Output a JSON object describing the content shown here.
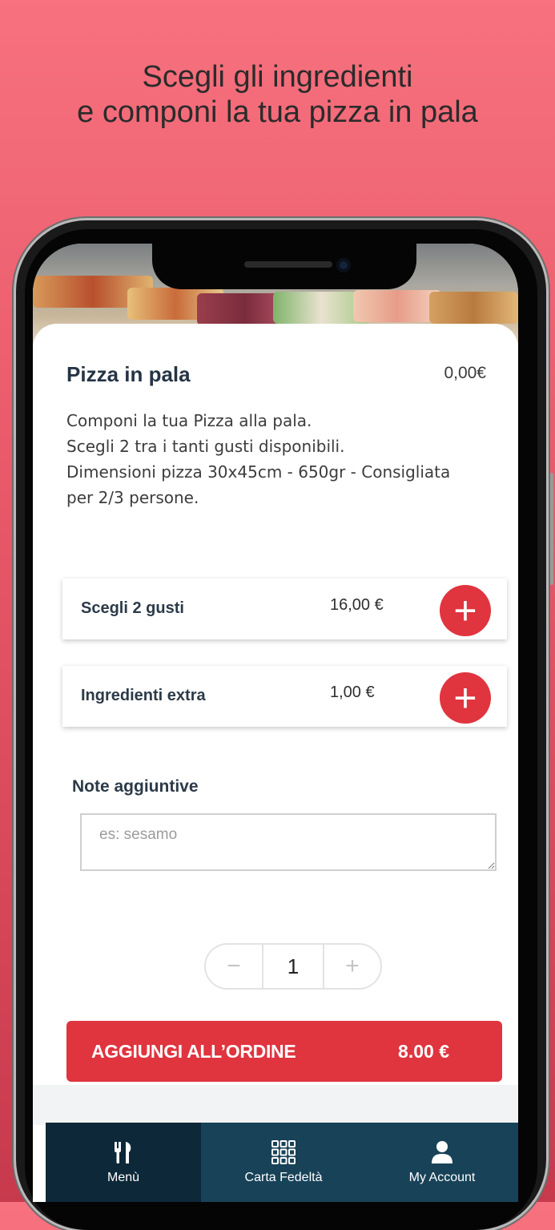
{
  "promo": {
    "line1": "Scegli gli ingredienti",
    "line2": "e componi la tua pizza in pala"
  },
  "product": {
    "title": "Pizza in pala",
    "price": "0,00€",
    "description": [
      "Componi la tua Pizza alla pala.",
      "Scegli 2 tra i tanti gusti disponibili.",
      "Dimensioni pizza 30x45cm - 650gr - Consigliata",
      "per 2/3 persone."
    ]
  },
  "options": [
    {
      "label": "Scegli 2 gusti",
      "price": "16,00 €",
      "button": "+"
    },
    {
      "label": "Ingredienti extra",
      "price": "1,00 €",
      "button": "+"
    }
  ],
  "notes": {
    "label": "Note aggiuntive",
    "placeholder": "es: sesamo",
    "value": ""
  },
  "quantity": {
    "minus": "−",
    "value": "1",
    "plus": "+"
  },
  "add_to_order": {
    "label": "AGGIUNGI ALL’ORDINE",
    "total": "8.00 €"
  },
  "tabs": [
    {
      "label": "Menù",
      "icon": "cutlery-icon",
      "active": true
    },
    {
      "label": "Carta Fedeltà",
      "icon": "grid-icon",
      "active": false
    },
    {
      "label": "My Account",
      "icon": "user-icon",
      "active": false
    }
  ],
  "colors": {
    "accent": "#e0343f",
    "nav": "#184258",
    "nav_active": "#0d2838",
    "background_top": "#f7717e",
    "background_bottom": "#c7394c"
  }
}
